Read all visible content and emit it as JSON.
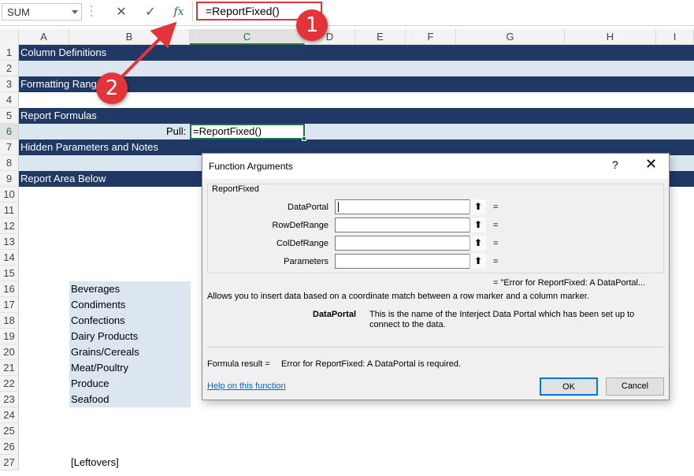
{
  "formula_bar": {
    "name_box": "SUM",
    "cancel_glyph": "✕",
    "confirm_glyph": "✓",
    "fx_glyph": "fx",
    "formula": "=ReportFixed()"
  },
  "columns": [
    "A",
    "B",
    "C",
    "D",
    "E",
    "F",
    "G",
    "H",
    "I"
  ],
  "rows": [
    "1",
    "2",
    "3",
    "4",
    "5",
    "6",
    "7",
    "8",
    "9",
    "10",
    "11",
    "12",
    "13",
    "14",
    "15",
    "16",
    "17",
    "18",
    "19",
    "20",
    "21",
    "22",
    "23",
    "24",
    "25",
    "26",
    "27"
  ],
  "sheet": {
    "section_1": "Column Definitions",
    "section_3": "Formatting Range",
    "section_5": "Report Formulas",
    "section_7": "Hidden Parameters and Notes",
    "section_9": "Report Area Below",
    "pull_label": "Pull:",
    "active_cell_value": "=ReportFixed()",
    "categories": [
      "Beverages",
      "Condiments",
      "Confections",
      "Dairy Products",
      "Grains/Cereals",
      "Meat/Poultry",
      "Produce",
      "Seafood"
    ],
    "leftovers": "[Leftovers]"
  },
  "dialog": {
    "title": "Function Arguments",
    "help": "?",
    "close": "✕",
    "function_name": "ReportFixed",
    "arguments": [
      {
        "label": "DataPortal",
        "value": ""
      },
      {
        "label": "RowDefRange",
        "value": ""
      },
      {
        "label": "ColDefRange",
        "value": ""
      },
      {
        "label": "Parameters",
        "value": ""
      }
    ],
    "ref_glyph": "⬆",
    "equals": "=",
    "preview_result": "=   \"Error for ReportFixed: A DataPortal...",
    "description": "Allows you to insert data based on a coordinate match between a row marker and a column marker.",
    "arg_help_name": "DataPortal",
    "arg_help_text_1": "This is the name of the Interject Data Portal which has been set up to",
    "arg_help_text_2": "connect to the data.",
    "formula_result_label": "Formula result =",
    "formula_result_value": "Error for ReportFixed: A DataPortal is required.",
    "help_link": "Help on this function",
    "ok": "OK",
    "cancel": "Cancel"
  },
  "callouts": {
    "first": "1",
    "second": "2"
  },
  "colors": {
    "excel_green": "#217346",
    "band_dark": "#1f3864",
    "band_light": "#dce6f1",
    "callout_red": "#e3343a",
    "dialog_bg": "#f0f0f0"
  }
}
